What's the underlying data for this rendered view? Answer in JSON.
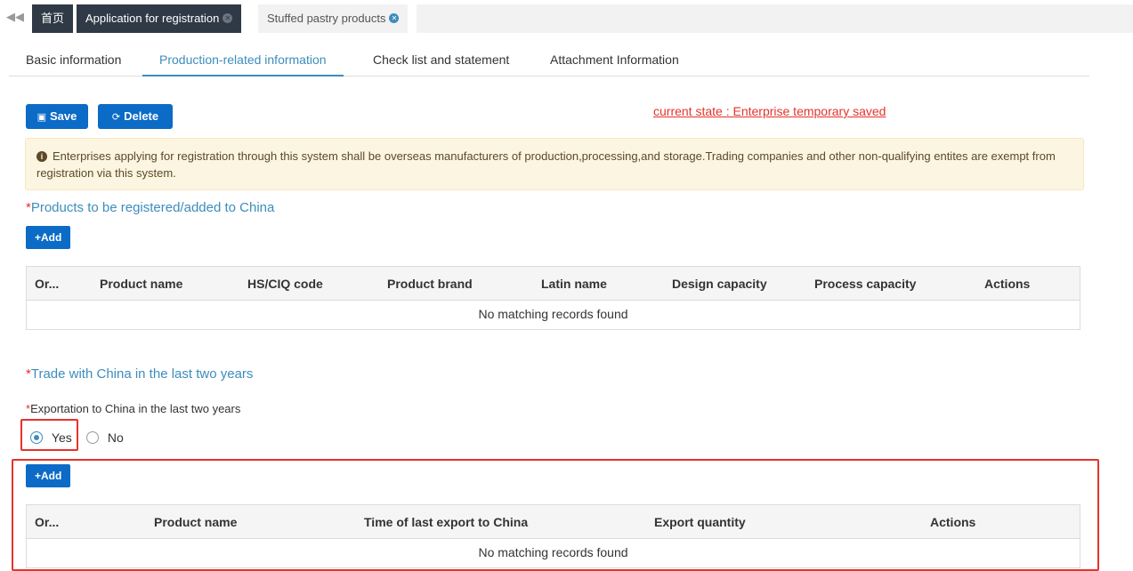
{
  "top_tabs": [
    {
      "label": "首页"
    },
    {
      "label": "Application for registration"
    },
    {
      "label": "Stuffed pastry products"
    }
  ],
  "icons": {
    "nav_back": "double-chevron-left-icon",
    "close": "close-circle-icon",
    "save": "floppy-icon",
    "delete": "refresh-icon",
    "info": "info-circle-icon"
  },
  "sub_tabs": [
    {
      "label": "Basic information"
    },
    {
      "label": "Production-related information"
    },
    {
      "label": "Check list and statement"
    },
    {
      "label": "Attachment Information"
    }
  ],
  "toolbar": {
    "save_label": "Save",
    "delete_label": "Delete"
  },
  "state_text": "current state : Enterprise temporary saved",
  "alert_text": "Enterprises applying for registration through this system shall be overseas manufacturers of production,processing,and storage.Trading companies and other non-qualifying entites are exempt from registration via this system.",
  "products_section": {
    "title": "Products to be registered/added to China",
    "add_label": "Add",
    "columns": [
      "Or...",
      "Product name",
      "HS/CIQ code",
      "Product brand",
      "Latin name",
      "Design capacity",
      "Process capacity",
      "Actions"
    ],
    "empty_text": "No matching records found"
  },
  "trade_section": {
    "title": "Trade with China in the last two years",
    "question": "Exportation to China in the last two years",
    "options": [
      "Yes",
      "No"
    ],
    "selected": "Yes",
    "add_label": "Add",
    "columns": [
      "Or...",
      "Product name",
      "Time of last export to China",
      "Export quantity",
      "Actions"
    ],
    "empty_text": "No matching records found"
  },
  "colors": {
    "primary": "#0b6bc6",
    "accent": "#3c8dbc",
    "danger": "#e5332b",
    "alert_bg": "#fcf5e1"
  }
}
